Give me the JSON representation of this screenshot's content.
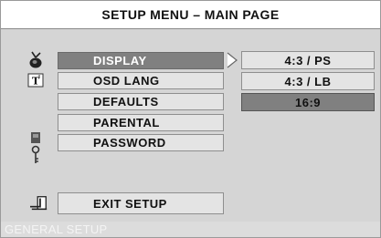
{
  "header": {
    "title": "SETUP MENU – MAIN PAGE"
  },
  "menu": {
    "items": [
      {
        "label": "DISPLAY",
        "selected": true
      },
      {
        "label": "OSD LANG",
        "selected": false
      },
      {
        "label": "DEFAULTS",
        "selected": false
      },
      {
        "label": "PARENTAL",
        "selected": false
      },
      {
        "label": "PASSWORD",
        "selected": false
      }
    ],
    "exit_label": "EXIT SETUP"
  },
  "submenu": {
    "options": [
      {
        "label": "4:3 / PS",
        "selected": false
      },
      {
        "label": "4:3 / LB",
        "selected": false
      },
      {
        "label": "16:9",
        "selected": true
      }
    ]
  },
  "footer": {
    "label": "GENERAL SETUP"
  },
  "icons": {
    "display": "tv-icon",
    "osd_lang": "text-icon",
    "password": "key-icon",
    "exit": "exit-icon"
  },
  "colors": {
    "selected_bg": "#808080",
    "item_bg": "#e4e4e4",
    "screen_bg": "#d5d5d5"
  }
}
